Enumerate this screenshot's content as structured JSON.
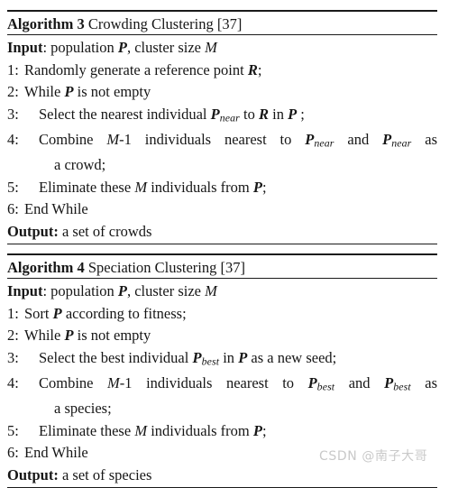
{
  "document": {
    "type": "algorithm-pseudocode-figure",
    "background_color": "#ffffff",
    "text_color": "#161616",
    "rule_color": "#1a1a1a"
  },
  "watermark": {
    "text": "CSDN @南子大哥",
    "color": "#c9c9c9"
  },
  "algorithms": [
    {
      "id": "algorithm-3",
      "title_keyword": "Algorithm",
      "title_number": "3",
      "title_name": "Crowding Clustering",
      "title_reference": "[37]",
      "input": {
        "label": "Input",
        "separator": ":",
        "text_1": "population ",
        "var_1": "P",
        "text_2": ", cluster size ",
        "var_2": "M"
      },
      "steps": [
        {
          "number": "1:",
          "indent": false,
          "text": "Randomly generate a reference point R;"
        },
        {
          "number": "2:",
          "indent": false,
          "text": "While P is not empty"
        },
        {
          "number": "3:",
          "indent": true,
          "text": "Select the nearest individual Pnear to R in P ;"
        },
        {
          "number": "4:",
          "indent": true,
          "justified": true,
          "text": "Combine M-1 individuals nearest to Pnear and Pnear as"
        },
        {
          "number": "",
          "continuation": true,
          "text": "a crowd;"
        },
        {
          "number": "5:",
          "indent": true,
          "text": "Eliminate these M individuals from P;"
        },
        {
          "number": "6:",
          "indent": false,
          "text": "End While"
        }
      ],
      "output": {
        "label": "Output:",
        "text": " a set of crowds"
      }
    },
    {
      "id": "algorithm-4",
      "title_keyword": "Algorithm",
      "title_number": "4",
      "title_name": "Speciation Clustering",
      "title_reference": "[37]",
      "input": {
        "label": "Input",
        "separator": ":",
        "text_1": "population ",
        "var_1": "P",
        "text_2": ", cluster size ",
        "var_2": "M"
      },
      "steps": [
        {
          "number": "1:",
          "indent": false,
          "text": "Sort P according to fitness;"
        },
        {
          "number": "2:",
          "indent": false,
          "text": "While P is not empty"
        },
        {
          "number": "3:",
          "indent": true,
          "text": "Select the best individual Pbest in P as a new seed;"
        },
        {
          "number": "4:",
          "indent": true,
          "justified": true,
          "text": "Combine M-1 individuals nearest to Pbest and Pbest as"
        },
        {
          "number": "",
          "continuation": true,
          "text": "a species;"
        },
        {
          "number": "5:",
          "indent": true,
          "text": "Eliminate these M individuals from P;"
        },
        {
          "number": "6:",
          "indent": false,
          "text": "End While"
        }
      ],
      "output": {
        "label": "Output:",
        "text": " a set of species"
      }
    }
  ],
  "a3": {
    "title": {
      "kw": "Algorithm",
      "num": "3",
      "name": "Crowding Clustering",
      "ref": "[37]"
    },
    "input": {
      "label": "Input",
      "colon": ": ",
      "t1": "population ",
      "v1": "P",
      "t2": ", cluster size ",
      "v2": "M"
    },
    "s1": {
      "n": "1:",
      "t1": "Randomly generate a reference point ",
      "v1": "R",
      "t2": ";"
    },
    "s2": {
      "n": "2:",
      "t1": "While ",
      "v1": "P",
      "t2": " is not empty"
    },
    "s3": {
      "n": "3:",
      "t1": "Select the nearest individual ",
      "v1": "P",
      "sub1": "near",
      "t2": " to ",
      "v2": "R",
      "t3": " in ",
      "v3": "P",
      "t4": " ;"
    },
    "s4": {
      "n": "4:",
      "t1": "Combine ",
      "v1": "M",
      "t2": "-1 individuals nearest to ",
      "v2": "P",
      "sub2": "near",
      "t3": " and ",
      "v3": "P",
      "sub3": "near",
      "t4": " as"
    },
    "s4c": {
      "t": "a crowd;"
    },
    "s5": {
      "n": "5:",
      "t1": "Eliminate these ",
      "v1": "M",
      "t2": " individuals from ",
      "v2": "P",
      "t3": ";"
    },
    "s6": {
      "n": "6:",
      "t1": "End While"
    },
    "output": {
      "label": "Output:",
      "t": " a set of crowds"
    }
  },
  "a4": {
    "title": {
      "kw": "Algorithm",
      "num": "4",
      "name": "Speciation Clustering",
      "ref": "[37]"
    },
    "input": {
      "label": "Input",
      "colon": ": ",
      "t1": "population ",
      "v1": "P",
      "t2": ", cluster size ",
      "v2": "M"
    },
    "s1": {
      "n": "1:",
      "t1": "Sort ",
      "v1": "P",
      "t2": " according to fitness;"
    },
    "s2": {
      "n": "2:",
      "t1": "While ",
      "v1": "P",
      "t2": " is not empty"
    },
    "s3": {
      "n": "3:",
      "t1": "Select the best individual ",
      "v1": "P",
      "sub1": "best",
      "t2": " in ",
      "v2": "P",
      "t3": " as a new seed;"
    },
    "s4": {
      "n": "4:",
      "t1": "Combine ",
      "v1": "M",
      "t2": "-1 individuals nearest to ",
      "v2": "P",
      "sub2": "best",
      "t3": " and ",
      "v3": "P",
      "sub3": "best",
      "t4": " as"
    },
    "s4c": {
      "t": "a species;"
    },
    "s5": {
      "n": "5:",
      "t1": "Eliminate these ",
      "v1": "M",
      "t2": " individuals from ",
      "v2": "P",
      "t3": ";"
    },
    "s6": {
      "n": "6:",
      "t1": "End While"
    },
    "output": {
      "label": "Output:",
      "t": " a set of species"
    }
  }
}
